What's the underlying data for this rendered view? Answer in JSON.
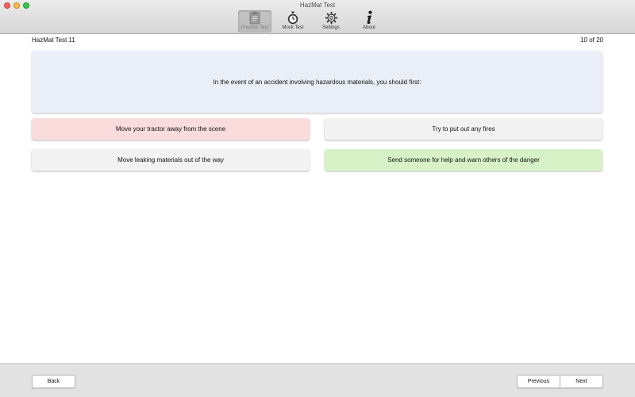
{
  "window": {
    "title": "HazMat Test"
  },
  "toolbar": {
    "items": [
      {
        "label": "Practice Test",
        "icon": "clipboard-icon",
        "active": true
      },
      {
        "label": "Mock Test",
        "icon": "stopwatch-icon",
        "active": false
      },
      {
        "label": "Settings",
        "icon": "gear-icon",
        "active": false
      },
      {
        "label": "About",
        "icon": "info-icon",
        "active": false
      }
    ]
  },
  "header": {
    "test_name": "HazMat Test 11",
    "progress": "10 of 20"
  },
  "question": {
    "text": "In the event of an accident involving hazardous materials, you should first:"
  },
  "answers": [
    {
      "text": "Move your tractor away from the scene",
      "state": "incorrect"
    },
    {
      "text": "Try to put out any fires",
      "state": "neutral"
    },
    {
      "text": "Move leaking materials out of the way",
      "state": "neutral"
    },
    {
      "text": "Send someone for help and warn others of the danger",
      "state": "correct"
    }
  ],
  "footer": {
    "back_label": "Back",
    "previous_label": "Previous",
    "next_label": "Next"
  },
  "colors": {
    "incorrect": "#fbdcdc",
    "correct": "#d8f2c8",
    "neutral": "#f2f2f2",
    "question_bg": "#e9eef7"
  }
}
